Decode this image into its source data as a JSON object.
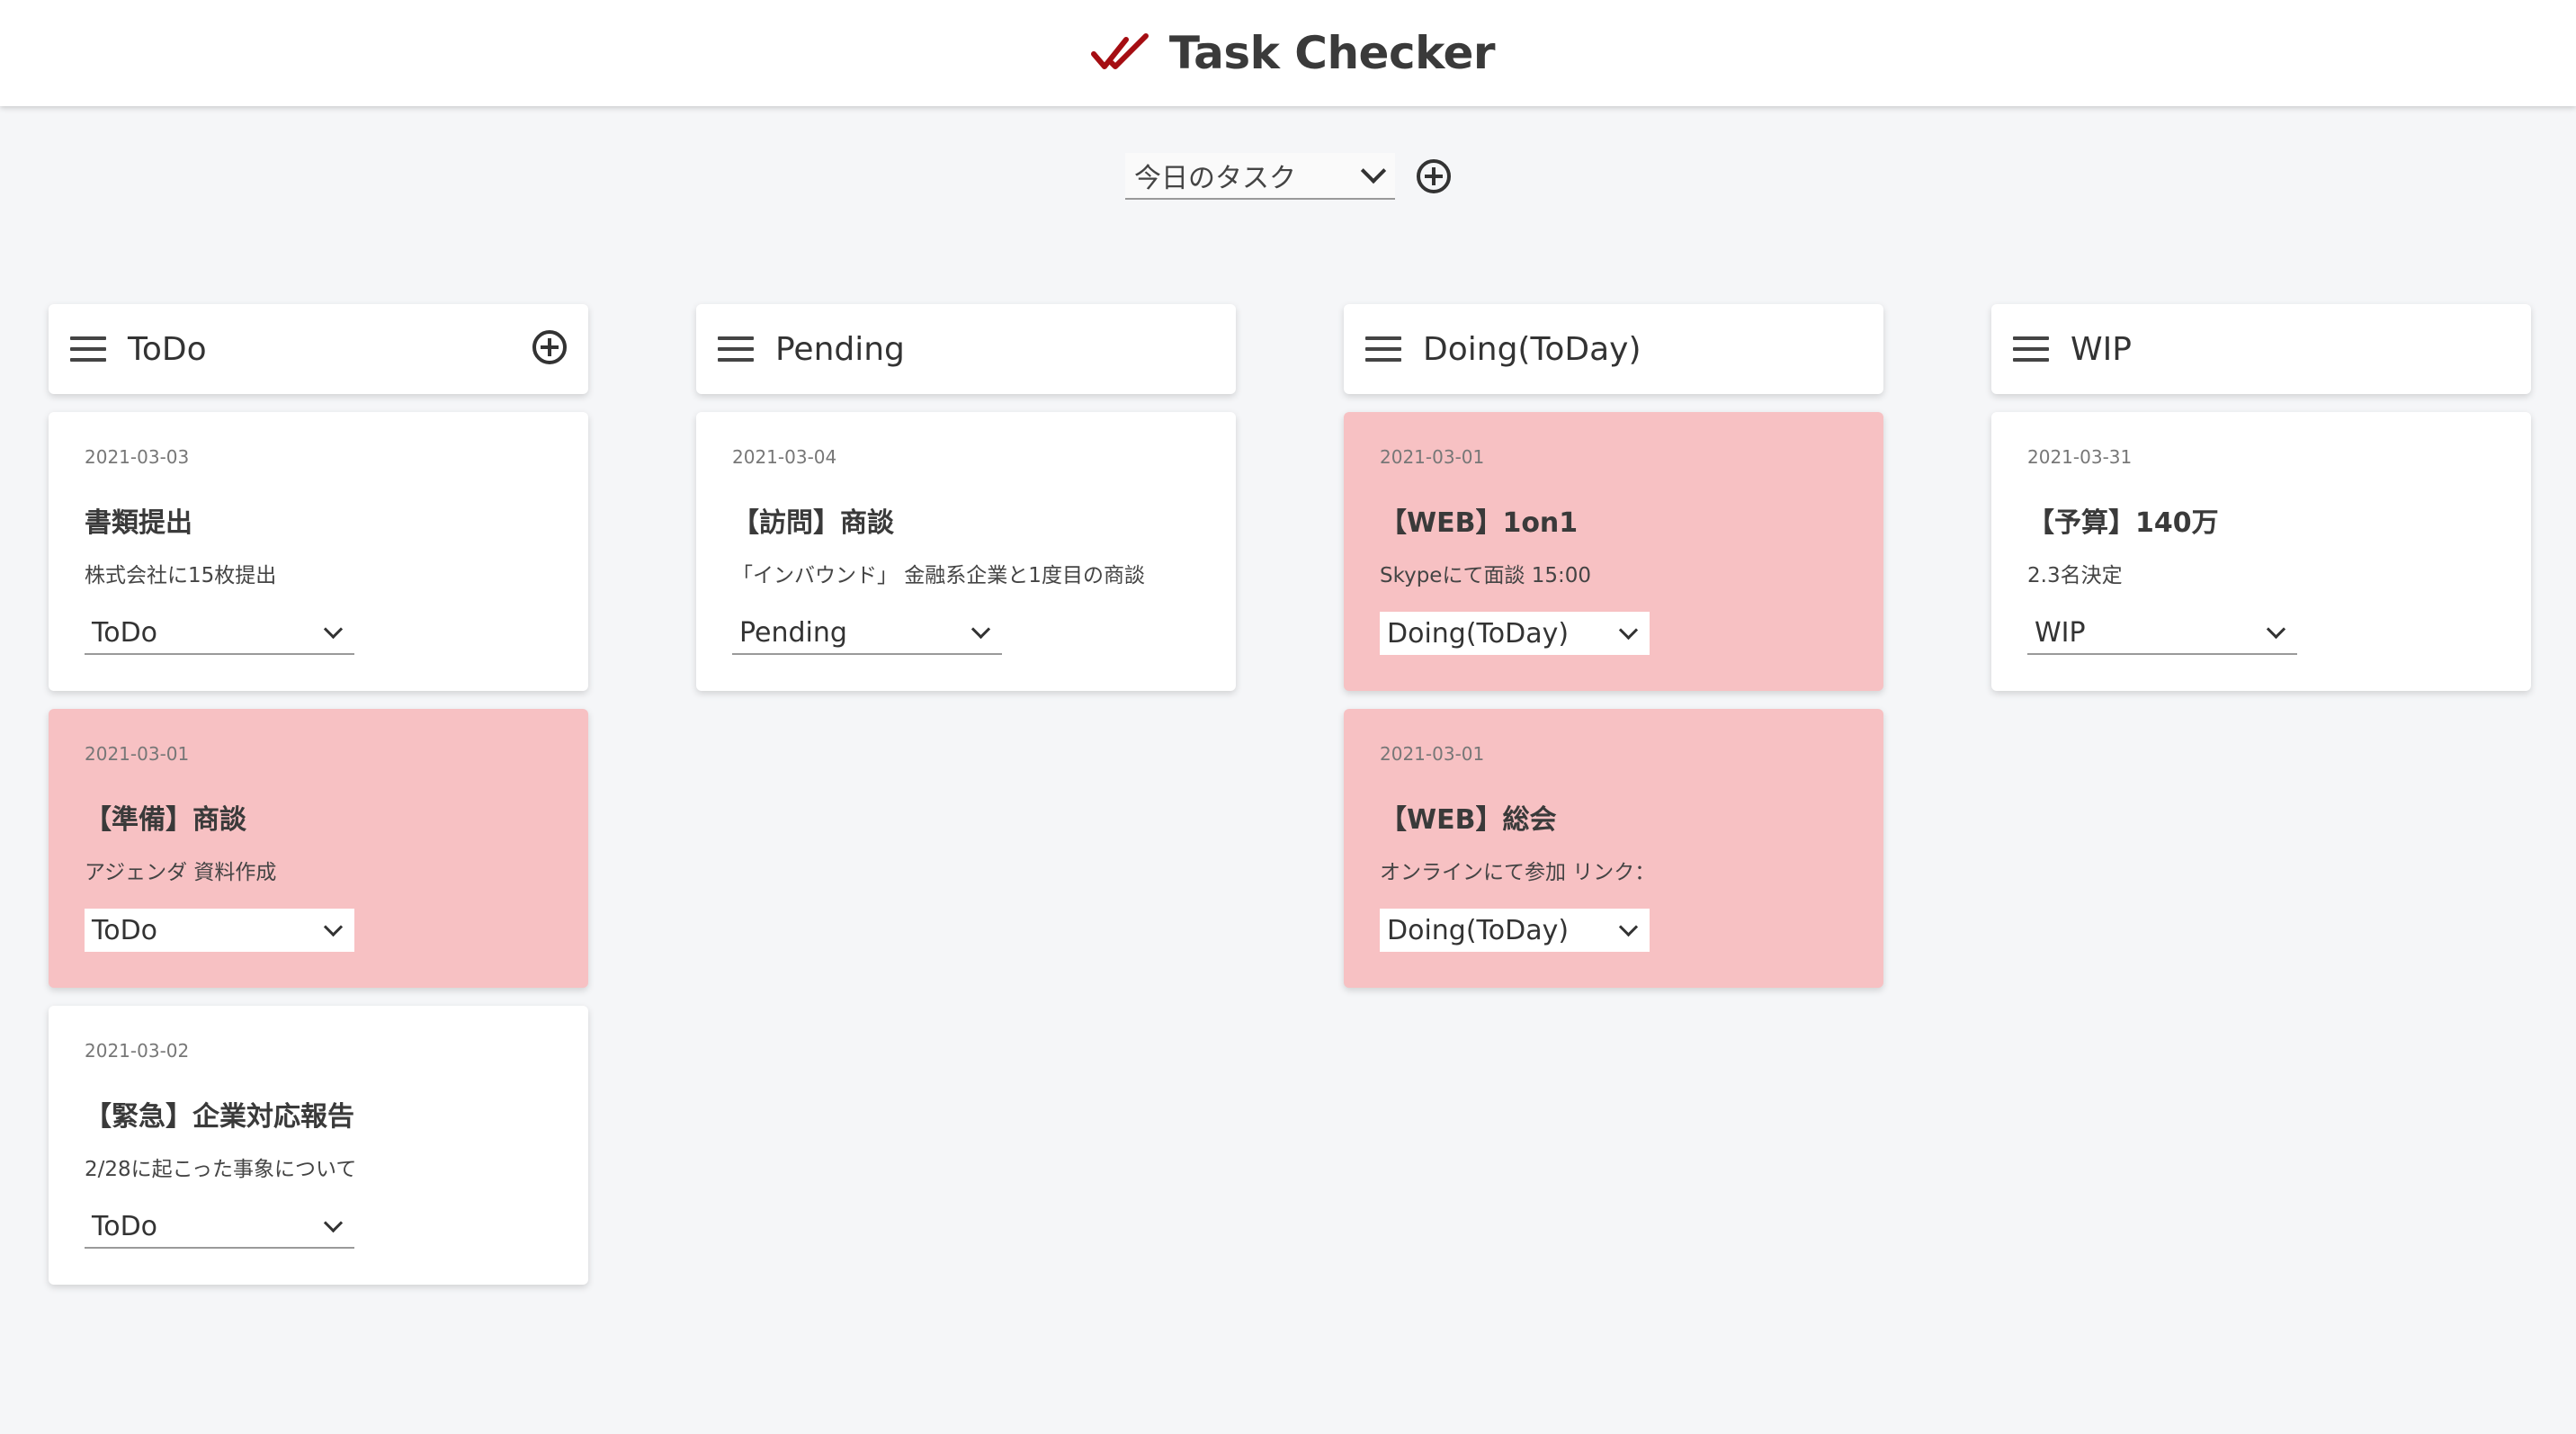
{
  "app": {
    "title": "Task Checker",
    "brand_color": "#a50d12",
    "icon": "double-check-icon"
  },
  "filter": {
    "selected": "今日のタスク",
    "add_icon": "add-circle-icon"
  },
  "colors": {
    "highlight_card": "#f7c1c3",
    "card": "#ffffff",
    "background": "#f5f6f8"
  },
  "columns": [
    {
      "title": "ToDo",
      "cards": [
        {
          "date": "2021-03-03",
          "title": "書類提出",
          "description": "株式会社に15枚提出",
          "status": "ToDo",
          "highlight": false
        },
        {
          "date": "2021-03-01",
          "title": "【準備】商談",
          "description": "アジェンダ 資料作成",
          "status": "ToDo",
          "highlight": true
        },
        {
          "date": "2021-03-02",
          "title": "【緊急】企業対応報告",
          "description": "2/28に起こった事象について",
          "status": "ToDo",
          "highlight": false
        }
      ]
    },
    {
      "title": "Pending",
      "cards": [
        {
          "date": "2021-03-04",
          "title": "【訪問】商談",
          "description": "「インバウンド」 金融系企業と1度目の商談",
          "status": "Pending",
          "highlight": false
        }
      ]
    },
    {
      "title": "Doing(ToDay)",
      "cards": [
        {
          "date": "2021-03-01",
          "title": "【WEB】1on1",
          "description": "Skypeにて面談 15:00",
          "status": "Doing(ToDay)",
          "highlight": true
        },
        {
          "date": "2021-03-01",
          "title": "【WEB】総会",
          "description": "オンラインにて参加 リンク：",
          "status": "Doing(ToDay)",
          "highlight": true
        }
      ]
    },
    {
      "title": "WIP",
      "cards": [
        {
          "date": "2021-03-31",
          "title": "【予算】140万",
          "description": "2.3名決定",
          "status": "WIP",
          "highlight": false
        }
      ]
    }
  ]
}
